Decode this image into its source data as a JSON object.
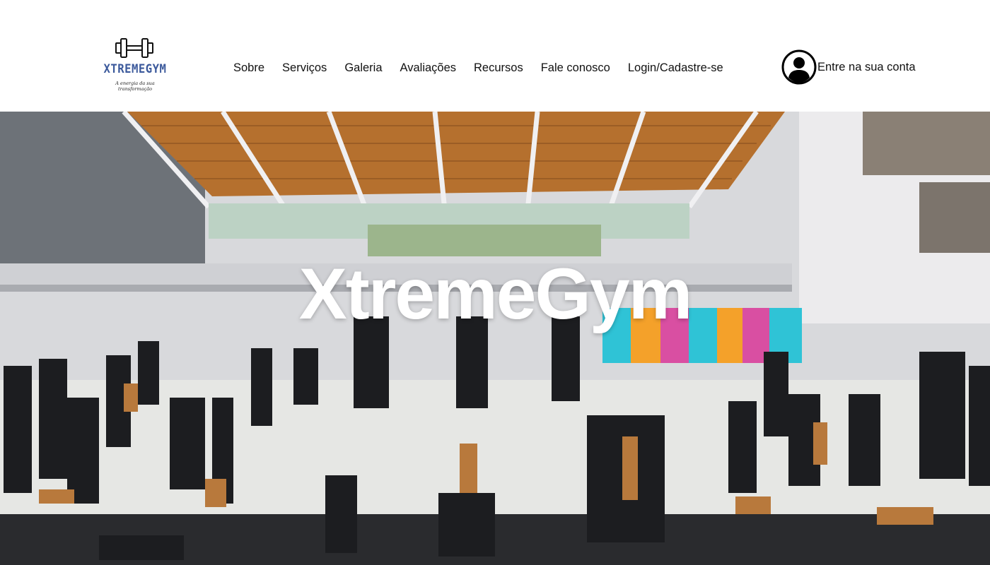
{
  "brand": {
    "name": "XTREMEGYM",
    "tagline": "A energia da sua transformação",
    "logo_icon": "dumbbell-icon",
    "logo_color": "#3c5a9c"
  },
  "nav": {
    "items": [
      {
        "label": "Sobre"
      },
      {
        "label": "Serviços"
      },
      {
        "label": "Galeria"
      },
      {
        "label": "Avaliações"
      },
      {
        "label": "Recursos"
      },
      {
        "label": "Fale conosco"
      },
      {
        "label": "Login/Cadastre-se"
      }
    ]
  },
  "account": {
    "icon": "user-circle-icon",
    "label": "Entre na sua conta"
  },
  "hero": {
    "title": "XtremeGym",
    "image": "gym-interior-photo",
    "colors": {
      "roof": "#b5702e",
      "floor": "#e6e7e4",
      "lockers_cyan": "#2fc3d6",
      "lockers_pink": "#d94fa2",
      "lockers_orange": "#f4a12a",
      "equipment": "#1c1d20",
      "seat": "#b8793c"
    }
  }
}
